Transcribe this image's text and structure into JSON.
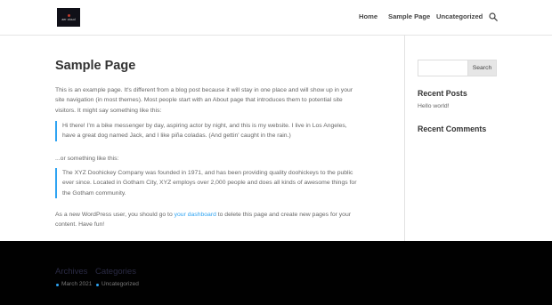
{
  "header": {
    "logo_text": "aer cloud",
    "nav": [
      {
        "label": "Home"
      },
      {
        "label": "Sample Page"
      },
      {
        "label": "Uncategorized"
      }
    ],
    "search_icon": "search-icon"
  },
  "main": {
    "title": "Sample Page",
    "intro_lines": [
      "This is an example page. It's different from a blog post because it will stay in one place and will show up in your",
      "site navigation (in most themes). Most people start with an About page that introduces them to potential site",
      "visitors. It might say something like this:"
    ],
    "quote1_lines": [
      "Hi there! I'm a bike messenger by day, aspiring actor by night, and this is my website. I live in Los Angeles,",
      "have a great dog named Jack, and I like piña coladas. (And gettin' caught in the rain.)"
    ],
    "middle_text": "...or something like this:",
    "quote2_lines": [
      "The XYZ Doohickey Company was founded in 1971, and has been providing quality doohickeys to the public",
      "ever since. Located in Gotham City, XYZ employs over 2,000 people and does all kinds of awesome things for",
      "the Gotham community."
    ],
    "outro_prefix": "As a new WordPress user, you should go to ",
    "outro_link": "your dashboard",
    "outro_suffix": " to delete this page and create new pages for your",
    "outro_line2": "content. Have fun!"
  },
  "sidebar": {
    "search_placeholder": "",
    "search_button": "Search",
    "recent_posts_title": "Recent Posts",
    "recent_posts": [
      "Hello world!"
    ],
    "recent_comments_title": "Recent Comments"
  },
  "footer": {
    "archives_title": "Archives",
    "categories_title": "Categories",
    "archives_item": "March 2021",
    "categories_item": "Uncategorized"
  },
  "colors": {
    "accent": "#2ea3f2",
    "footer_bg": "#010101",
    "title": "#333333",
    "text": "#666666"
  }
}
